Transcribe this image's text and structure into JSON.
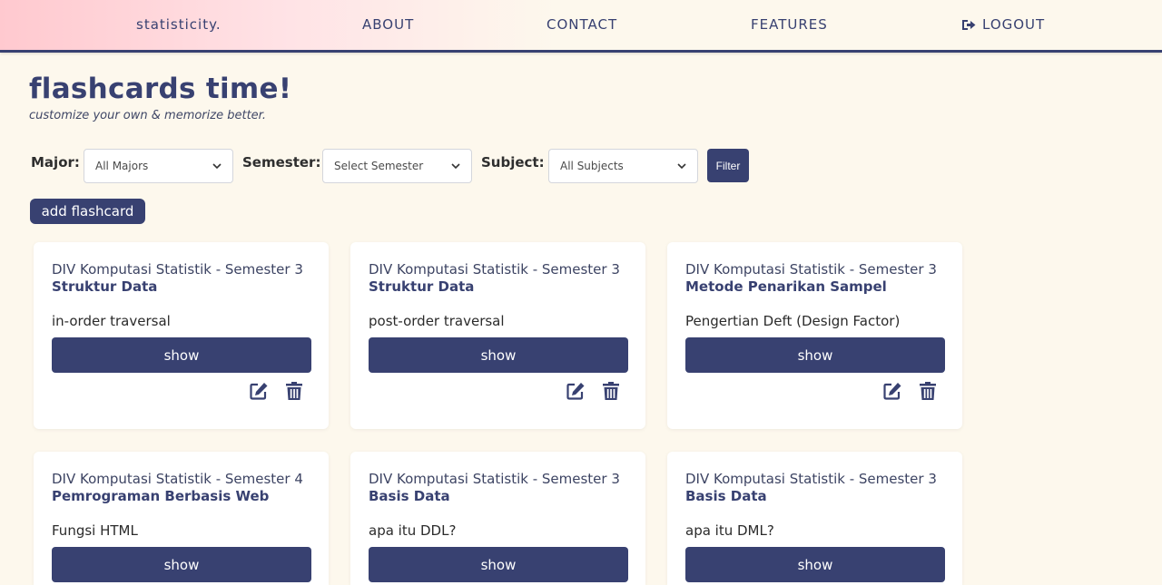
{
  "navbar": {
    "brand": "statisticity.",
    "about": "ABOUT",
    "contact": "CONTACT",
    "features": "FEATURES",
    "logout": "LOGOUT",
    "logout_icon": "sign-out-icon"
  },
  "page": {
    "title": "flashcards time!",
    "subtitle": "customize your own & memorize better."
  },
  "filters": {
    "major_label": "Major:",
    "major_value": "All Majors",
    "semester_label": "Semester:",
    "semester_value": "Select Semester",
    "subject_label": "Subject:",
    "subject_value": "All Subjects",
    "filter_button": "Filter"
  },
  "add_button": "add flashcard",
  "cards": [
    {
      "major": "DIV Komputasi Statistik - Semester 3",
      "subject": "Struktur Data",
      "question": "in-order traversal",
      "show": "show"
    },
    {
      "major": "DIV Komputasi Statistik - Semester 3",
      "subject": "Struktur Data",
      "question": "post-order traversal",
      "show": "show"
    },
    {
      "major": "DIV Komputasi Statistik - Semester 3",
      "subject": "Metode Penarikan Sampel",
      "question": "Pengertian Deft (Design Factor)",
      "show": "show"
    },
    {
      "major": "DIV Komputasi Statistik - Semester 4",
      "subject": "Pemrograman Berbasis Web",
      "question": "Fungsi HTML",
      "show": "show"
    },
    {
      "major": "DIV Komputasi Statistik - Semester 3",
      "subject": "Basis Data",
      "question": "apa itu DDL?",
      "show": "show"
    },
    {
      "major": "DIV Komputasi Statistik - Semester 3",
      "subject": "Basis Data",
      "question": "apa itu DML?",
      "show": "show"
    }
  ],
  "icons": {
    "edit": "edit-icon",
    "delete": "trash-icon",
    "dropdown": "chevron-down-icon"
  },
  "colors": {
    "primary": "#384171",
    "background": "#fdf8ed",
    "navbar_accent": "#ffc9cf"
  }
}
